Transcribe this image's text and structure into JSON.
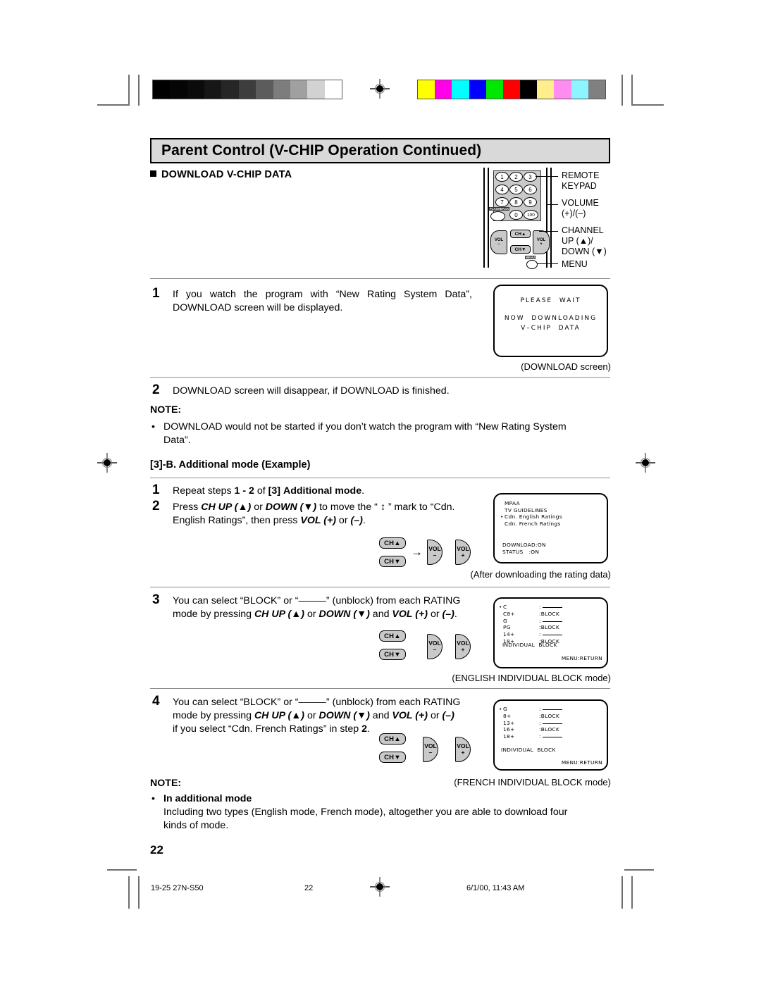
{
  "header": {
    "title": "Parent Control (V-CHIP Operation Continued)",
    "section": "DOWNLOAD V-CHIP DATA"
  },
  "remote": {
    "keys": [
      "1",
      "2",
      "3",
      "4",
      "5",
      "6",
      "7",
      "8",
      "9",
      "0",
      "100"
    ],
    "flashback_label": "FLASHBACK",
    "ch_up_label": "CH▲",
    "ch_down_label": "CH▼",
    "vol_minus_label": "VOL",
    "vol_minus_sign": "–",
    "vol_plus_label": "VOL",
    "vol_plus_sign": "+",
    "menu_label": "MENU",
    "callouts": [
      "REMOTE\nKEYPAD",
      "VOLUME\n(+)/(–)",
      "CHANNEL\nUP (▲)/\nDOWN (▼)",
      "MENU"
    ]
  },
  "steps_main": [
    {
      "num": "1",
      "line1": "If you watch the program with “New Rating System Data”,",
      "line2": "DOWNLOAD screen will be displayed."
    },
    {
      "num": "2",
      "line1": "DOWNLOAD screen will disappear, if DOWNLOAD is finished."
    }
  ],
  "download_screen": {
    "line1": "PLEASE  WAIT",
    "line2": "NOW  DOWNLOADING",
    "line3": "V–CHIP  DATA",
    "caption": "(DOWNLOAD screen)"
  },
  "note1": {
    "label": "NOTE:",
    "bullet": "•",
    "line1": "DOWNLOAD would not be started if you don’t watch the program with “New Rating System",
    "line2": "Data”."
  },
  "subsection": "[3]-B. Additional mode (Example)",
  "steps_b": [
    {
      "num": "1",
      "parts": [
        "Repeat steps ",
        "1 - 2",
        " of ",
        "[3]",
        " ",
        "Additional mode",
        "."
      ]
    },
    {
      "num": "2",
      "line1_a": "Press ",
      "line1_b": "CH UP (▲)",
      "line1_c": " or ",
      "line1_d": "DOWN (▼)",
      "line1_e": " to move the “ ↕ ” mark to “Cdn.",
      "line2_a": "English Ratings”, then press ",
      "line2_b": "VOL (+)",
      "line2_c": " or ",
      "line2_d": "(–)",
      "line2_e": "."
    },
    {
      "num": "3",
      "line1": "You can select “BLOCK” or “–––––” (unblock) from each RATING",
      "line2_a": "mode by pressing ",
      "line2_b": "CH UP (▲)",
      "line2_c": " or ",
      "line2_d": "DOWN (▼)",
      "line2_e": "  and ",
      "line2_f": "VOL (+)",
      "line2_g": " or ",
      "line2_h": "(–)",
      "line2_i": "."
    },
    {
      "num": "4",
      "line1": "You can select “BLOCK” or “–––––” (unblock) from each RATING",
      "line2_a": "mode by pressing ",
      "line2_b": "CH UP (▲)",
      "line2_c": " or ",
      "line2_d": "DOWN (▼)",
      "line2_e": "  and ",
      "line2_f": "VOL (+)",
      "line2_g": " or ",
      "line2_h": "(–)",
      "line3_a": "if you select “Cdn. French Ratings” in step ",
      "line3_b": "2",
      "line3_c": "."
    }
  ],
  "rating_menu_screen": {
    "items": [
      "MPAA",
      "TV GUIDELINES",
      "Cdn. English Ratings",
      "Cdn. French Ratings"
    ],
    "cursor_index": 2,
    "download_row": "DOWNLOAD:ON",
    "status_row": "STATUS   :ON",
    "caption": "(After downloading the rating data)"
  },
  "english_block_screen": {
    "rows": [
      {
        "label": "C",
        "value": "",
        "cursor": true
      },
      {
        "label": "C8+",
        "value": "BLOCK",
        "cursor": false
      },
      {
        "label": "G",
        "value": "",
        "cursor": false
      },
      {
        "label": "PG",
        "value": "BLOCK",
        "cursor": false
      },
      {
        "label": "14+",
        "value": "",
        "cursor": false
      },
      {
        "label": "18+",
        "value": "BLOCK",
        "cursor": false
      }
    ],
    "title": "INDIVIDUAL  BLOCK",
    "return_row": "MENU:RETURN",
    "caption": "(ENGLISH INDIVIDUAL BLOCK mode)"
  },
  "french_block_screen": {
    "rows": [
      {
        "label": "G",
        "value": "",
        "cursor": true
      },
      {
        "label": "8+",
        "value": "BLOCK",
        "cursor": false
      },
      {
        "label": "13+",
        "value": "",
        "cursor": false
      },
      {
        "label": "16+",
        "value": "BLOCK",
        "cursor": false
      },
      {
        "label": "18+",
        "value": "",
        "cursor": false
      }
    ],
    "title": "INDIVIDUAL  BLOCK",
    "return_row": "MENU:RETURN",
    "caption": "(FRENCH INDIVIDUAL BLOCK mode)"
  },
  "note2": {
    "label": "NOTE:",
    "bullet": "•",
    "heading": "In additional mode",
    "line1": "Including two types (English mode, French mode), altogether you are able to download four",
    "line2": "kinds of mode."
  },
  "page_number": "22",
  "footer": {
    "left": "19-25 27N-S50",
    "center": "22",
    "right": "6/1/00, 11:43 AM"
  },
  "colorbars": {
    "gray_ramp": [
      "#000000",
      "#050505",
      "#0b0b0b",
      "#161616",
      "#262626",
      "#3d3d3d",
      "#5c5c5c",
      "#7d7d7d",
      "#a0a0a0",
      "#d2d2d2",
      "#ffffff"
    ],
    "colors": [
      "#ffff00",
      "#ff00e8",
      "#00ffff",
      "#0000ff",
      "#00e800",
      "#ff0000",
      "#000000",
      "#ffef8c",
      "#ff8cf0",
      "#8cf5ff",
      "#808080"
    ]
  }
}
